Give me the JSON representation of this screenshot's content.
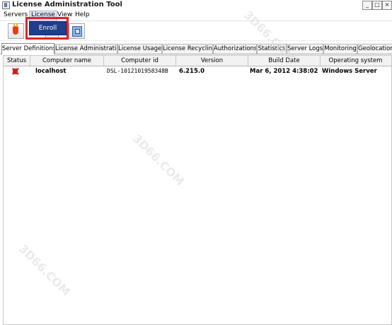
{
  "window": {
    "title": "License Administration Tool",
    "controls": [
      "_",
      "□",
      "×"
    ]
  },
  "menu": {
    "items": [
      "Servers",
      "License",
      "View",
      "Help"
    ]
  },
  "dropdown": {
    "item": "Enroll"
  },
  "tabs": [
    "Server Definitions",
    "License Administration",
    "License Usage",
    "License Recycling",
    "Authorizations",
    "Statistics",
    "Server Logs",
    "Monitoring",
    "Geolocation"
  ],
  "table": {
    "headers": [
      "Status",
      "Computer name",
      "Computer id",
      "Version",
      "Build Date",
      "Operating system"
    ],
    "rows": [
      {
        "computer_name": "localhost",
        "computer_id": "DSL-1012101958348B",
        "version": "6.215.0",
        "build_date": "Mar 6, 2012 4:38:02",
        "operating_system": "Windows Server"
      }
    ]
  },
  "watermarks": [
    "3D66.COM",
    "3D66.COM",
    "3D66.COM"
  ],
  "colors": {
    "menu_highlight": "#1f3e8c",
    "highlight_box": "#e2222a"
  }
}
